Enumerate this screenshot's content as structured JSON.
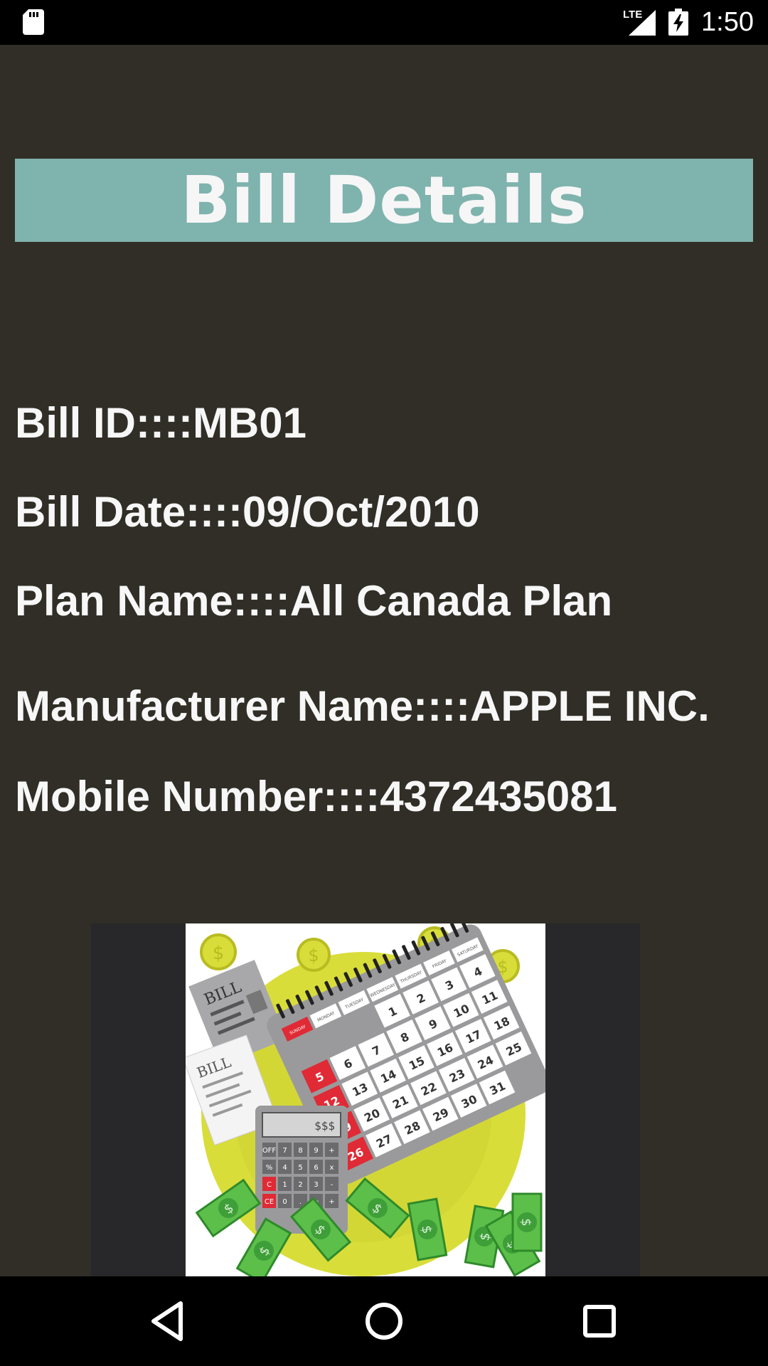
{
  "status_bar": {
    "network": "LTE",
    "time": "1:50",
    "icons": [
      "sd-card-icon",
      "signal-icon",
      "battery-charging-icon"
    ]
  },
  "title": "Bill Details",
  "details": [
    {
      "label": "Bill ID",
      "separator": "::::",
      "value": "MB01"
    },
    {
      "label": "Bill Date",
      "separator": "::::",
      "value": "09/Oct/2010"
    },
    {
      "label": "Plan Name",
      "separator": "::::",
      "value": "All Canada Plan"
    },
    {
      "label": "Manufacturer Name",
      "separator": "::::",
      "value": "APPLE INC."
    },
    {
      "label": "Mobile Number",
      "separator": "::::",
      "value": "4372435081"
    }
  ],
  "illustration": {
    "bill_labels": [
      "BILL",
      "BILL"
    ],
    "calendar_headers": [
      "SUNDAY",
      "MONDAY",
      "TUESDAY",
      "WEDNESDAY",
      "THURSDAY",
      "FRIDAY",
      "SATURDAY"
    ],
    "calendar_days": [
      "1",
      "2",
      "3",
      "4",
      "5",
      "6",
      "7",
      "8",
      "9",
      "10",
      "11",
      "12",
      "13",
      "14",
      "15",
      "16",
      "17",
      "18",
      "19",
      "20",
      "21",
      "22",
      "23",
      "24",
      "25",
      "26",
      "27",
      "28",
      "29",
      "30",
      "31"
    ],
    "calculator_display": "$$$",
    "calculator_keys": [
      "OFF",
      "7",
      "8",
      "9",
      "+",
      "%",
      "4",
      "5",
      "6",
      "x",
      "C",
      "1",
      "2",
      "3",
      "-",
      "CE",
      "0",
      ".",
      "=",
      "+"
    ],
    "colors": {
      "red": "#e02a35",
      "green": "#5cbf4a",
      "yellow": "#d9dd3a",
      "gray": "#9a9a9c"
    }
  },
  "nav_bar": {
    "buttons": [
      "back-icon",
      "home-icon",
      "recents-icon"
    ]
  }
}
